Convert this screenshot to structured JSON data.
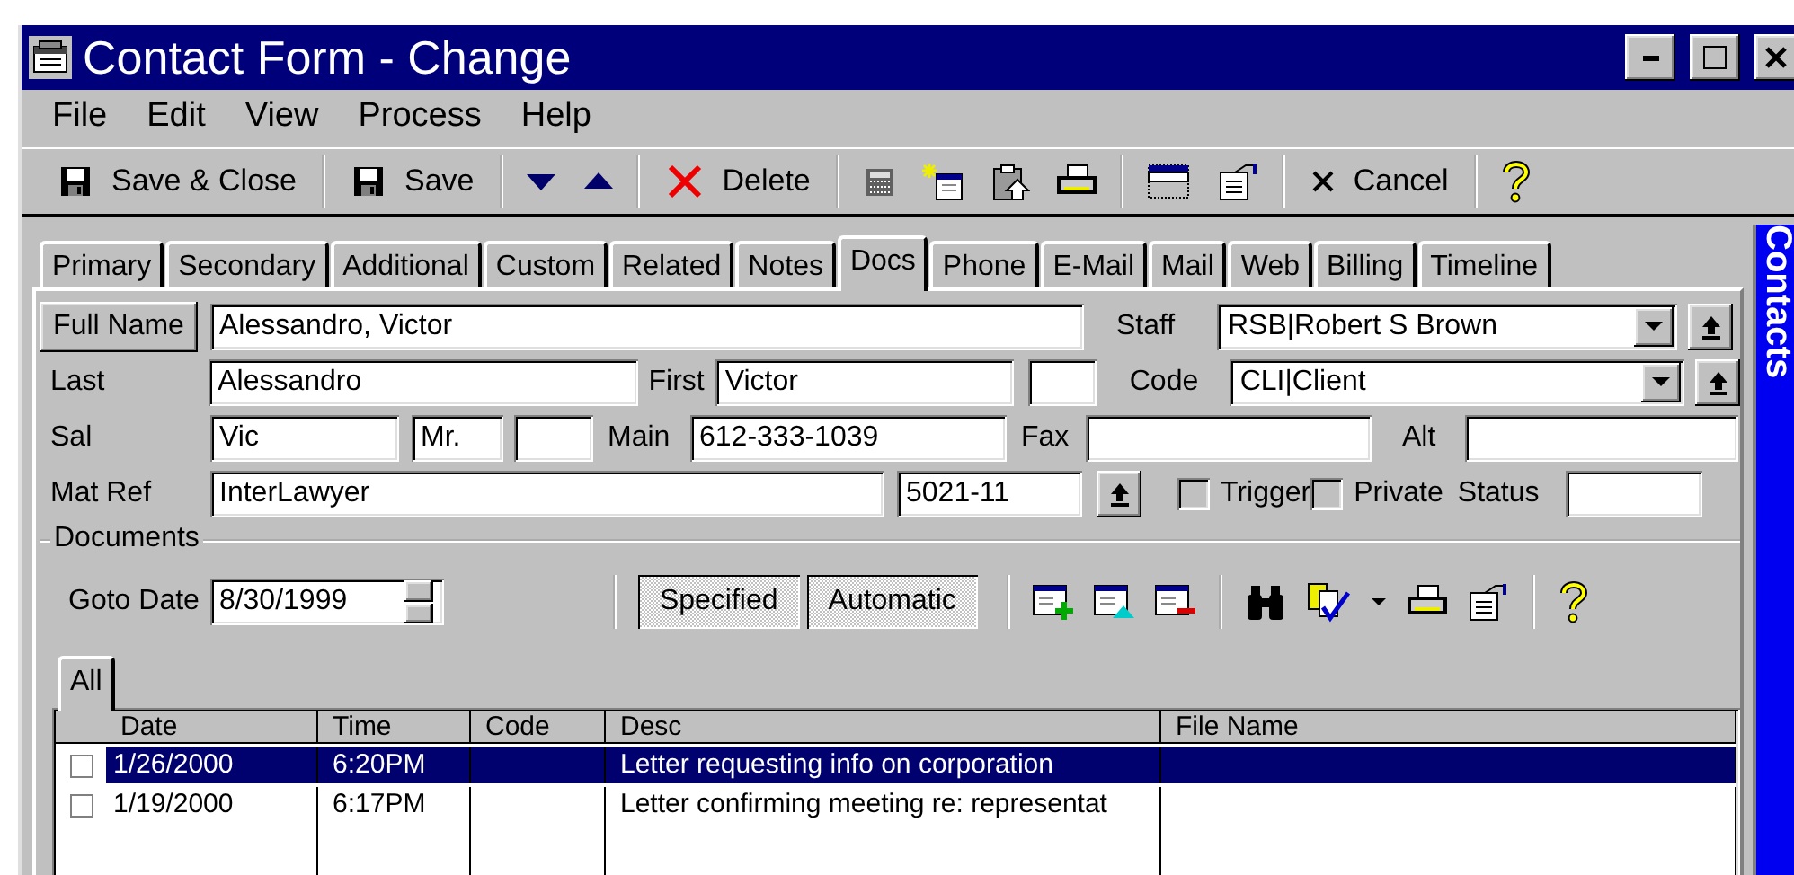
{
  "window": {
    "title": "Contact Form - Change"
  },
  "menu": [
    {
      "label": "File"
    },
    {
      "label": "Edit"
    },
    {
      "label": "View"
    },
    {
      "label": "Process"
    },
    {
      "label": "Help"
    }
  ],
  "toolbar": [
    {
      "label": "Save & Close"
    },
    {
      "label": "Save"
    },
    {
      "label": "Delete"
    },
    {
      "label": "Cancel"
    }
  ],
  "tabs": [
    {
      "label": "Primary",
      "selected": false
    },
    {
      "label": "Secondary",
      "selected": false
    },
    {
      "label": "Additional",
      "selected": false
    },
    {
      "label": "Custom",
      "selected": false
    },
    {
      "label": "Related",
      "selected": false
    },
    {
      "label": "Notes",
      "selected": false
    },
    {
      "label": "Docs",
      "selected": true
    },
    {
      "label": "Phone",
      "selected": false
    },
    {
      "label": "E-Mail",
      "selected": false
    },
    {
      "label": "Mail",
      "selected": false
    },
    {
      "label": "Web",
      "selected": false
    },
    {
      "label": "Billing",
      "selected": false
    },
    {
      "label": "Timeline",
      "selected": false
    }
  ],
  "side_panel": {
    "title": "Contacts"
  },
  "form": {
    "full_name_button": "Full Name",
    "full_name": "Alessandro, Victor",
    "staff_label": "Staff",
    "staff": "RSB|Robert S Brown",
    "last_label": "Last",
    "last": "Alessandro",
    "first_label": "First",
    "first": "Victor",
    "code_label": "Code",
    "code": "CLI|Client",
    "sal_label": "Sal",
    "sal": "Vic",
    "salutation": "Mr.",
    "main_label": "Main",
    "main": "612-333-1039",
    "fax_label": "Fax",
    "alt_label": "Alt",
    "mat_ref_label": "Mat Ref",
    "mat_ref": "InterLawyer",
    "matter_number": "5021-11",
    "trigger": {
      "label": "Trigger",
      "checked": false
    },
    "private": {
      "label": "Private",
      "checked": false
    },
    "status_label": "Status"
  },
  "documents": {
    "title": "Documents",
    "goto_label": "Goto Date",
    "goto_date": "8/30/1999",
    "modes": [
      {
        "label": "Specified",
        "selected": true
      },
      {
        "label": "Automatic",
        "selected": true
      }
    ],
    "tabs": [
      {
        "label": "All",
        "selected": true
      }
    ],
    "table": {
      "columns": [
        "Date",
        "Time",
        "Code",
        "Desc",
        "File Name"
      ],
      "rows": [
        {
          "checked": false,
          "selected": true,
          "date": "1/26/2000",
          "time": "6:20PM",
          "desc": "Letter requesting info on corporation"
        },
        {
          "checked": false,
          "selected": false,
          "date": "1/19/2000",
          "time": "6:17PM",
          "desc": "Letter confirming meeting re: representat"
        }
      ]
    }
  }
}
